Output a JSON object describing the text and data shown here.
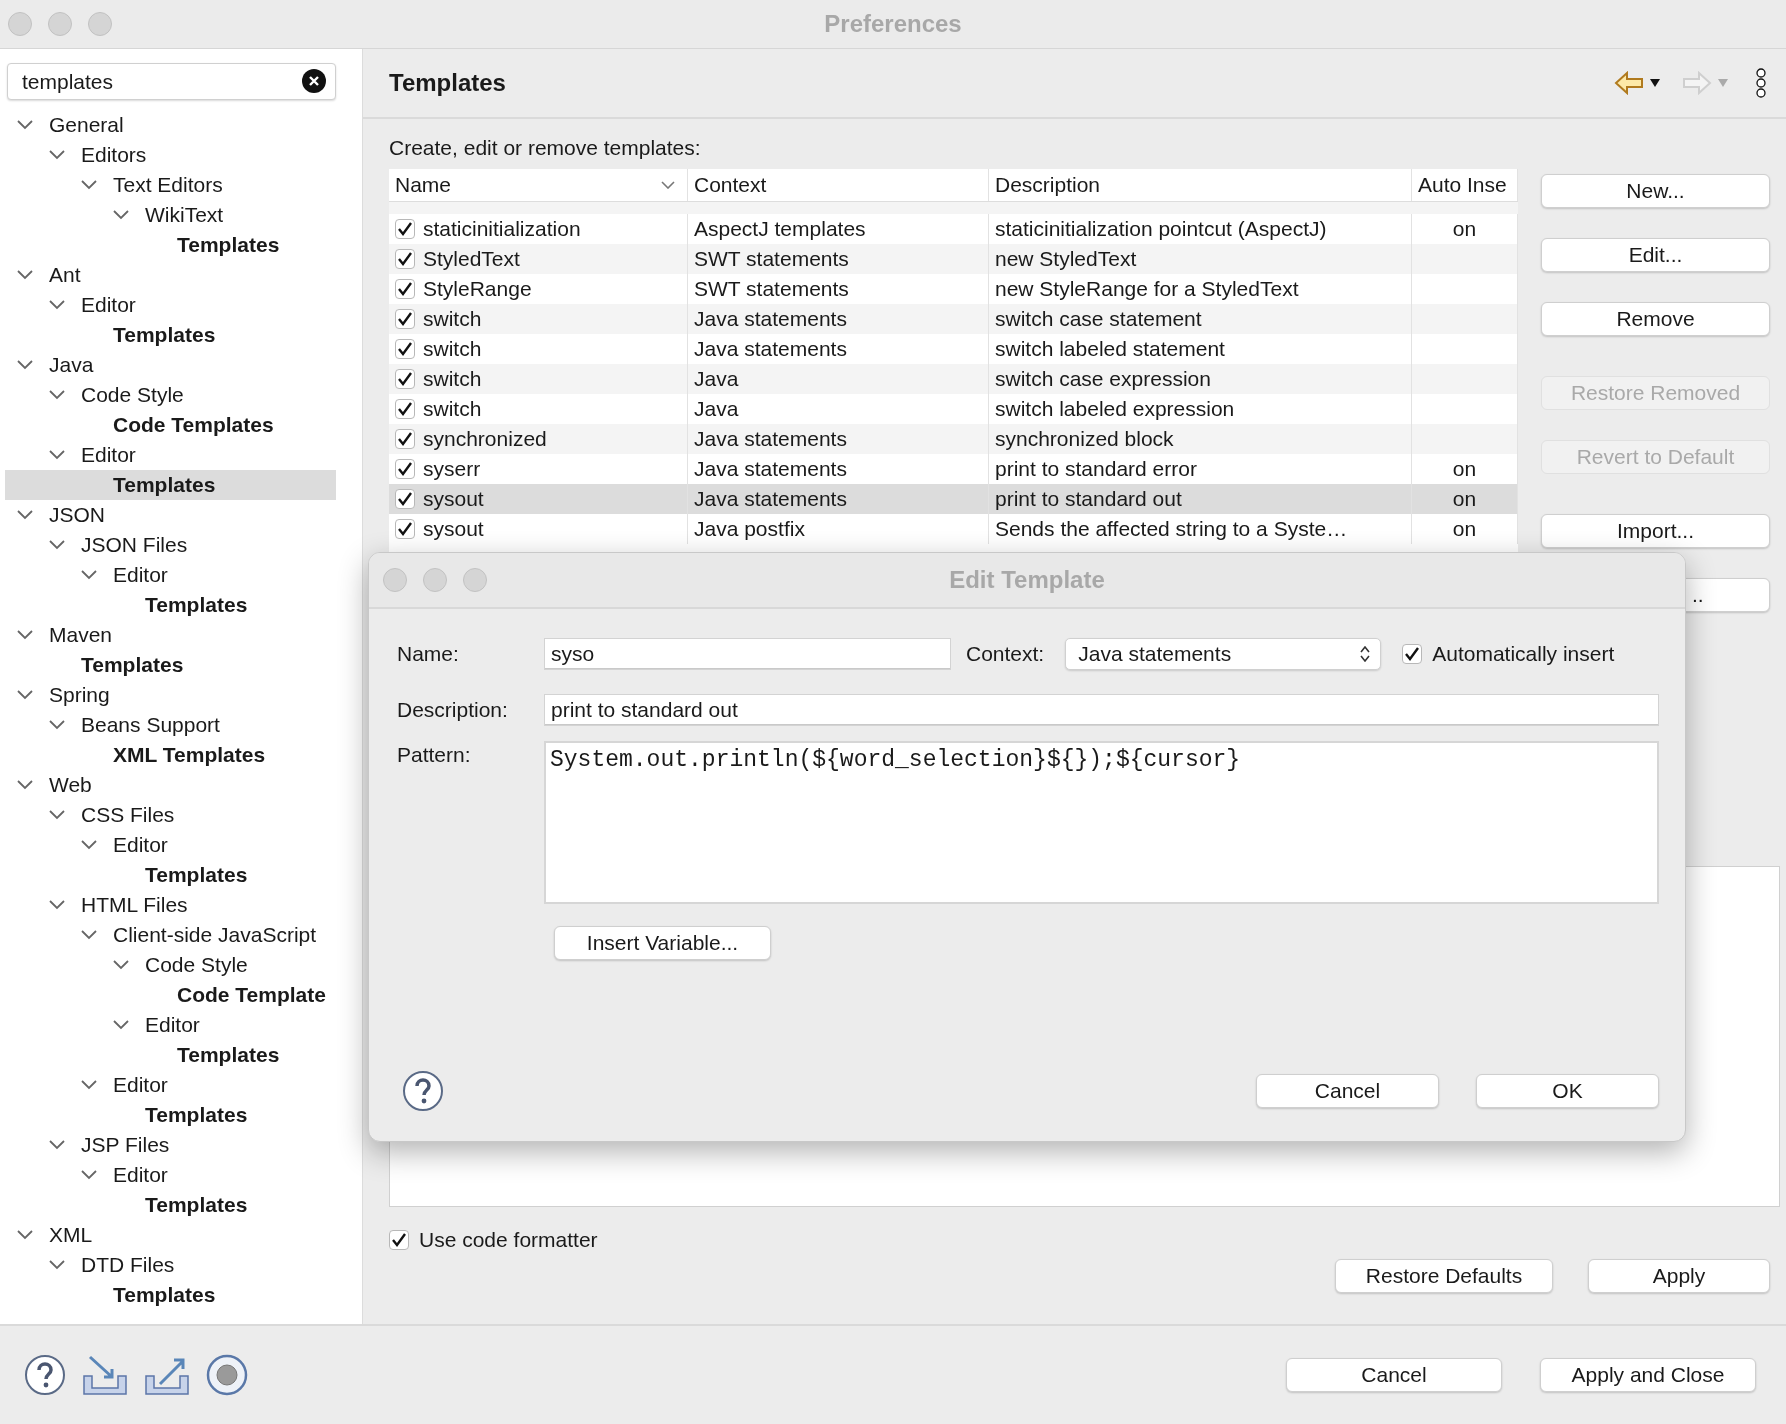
{
  "window": {
    "title": "Preferences"
  },
  "sidebar": {
    "search": {
      "value": "templates"
    },
    "tree": [
      {
        "label": "General",
        "bold": false,
        "selected": false,
        "expanded": true,
        "children": [
          {
            "label": "Editors",
            "bold": false,
            "selected": false,
            "expanded": true,
            "children": [
              {
                "label": "Text Editors",
                "bold": false,
                "selected": false,
                "expanded": true,
                "children": [
                  {
                    "label": "WikiText",
                    "bold": false,
                    "selected": false,
                    "expanded": true,
                    "children": [
                      {
                        "label": "Templates",
                        "bold": true,
                        "selected": false
                      }
                    ]
                  }
                ]
              }
            ]
          }
        ]
      },
      {
        "label": "Ant",
        "bold": false,
        "selected": false,
        "expanded": true,
        "children": [
          {
            "label": "Editor",
            "bold": false,
            "selected": false,
            "expanded": true,
            "children": [
              {
                "label": "Templates",
                "bold": true,
                "selected": false
              }
            ]
          }
        ]
      },
      {
        "label": "Java",
        "bold": false,
        "selected": false,
        "expanded": true,
        "children": [
          {
            "label": "Code Style",
            "bold": false,
            "selected": false,
            "expanded": true,
            "children": [
              {
                "label": "Code Templates",
                "bold": true,
                "selected": false
              }
            ]
          },
          {
            "label": "Editor",
            "bold": false,
            "selected": false,
            "expanded": true,
            "children": [
              {
                "label": "Templates",
                "bold": true,
                "selected": true
              }
            ]
          }
        ]
      },
      {
        "label": "JSON",
        "bold": false,
        "selected": false,
        "expanded": true,
        "children": [
          {
            "label": "JSON Files",
            "bold": false,
            "selected": false,
            "expanded": true,
            "children": [
              {
                "label": "Editor",
                "bold": false,
                "selected": false,
                "expanded": true,
                "children": [
                  {
                    "label": "Templates",
                    "bold": true,
                    "selected": false
                  }
                ]
              }
            ]
          }
        ]
      },
      {
        "label": "Maven",
        "bold": false,
        "selected": false,
        "expanded": true,
        "children": [
          {
            "label": "Templates",
            "bold": true,
            "selected": false
          }
        ]
      },
      {
        "label": "Spring",
        "bold": false,
        "selected": false,
        "expanded": true,
        "children": [
          {
            "label": "Beans Support",
            "bold": false,
            "selected": false,
            "expanded": true,
            "children": [
              {
                "label": "XML Templates",
                "bold": true,
                "selected": false
              }
            ]
          }
        ]
      },
      {
        "label": "Web",
        "bold": false,
        "selected": false,
        "expanded": true,
        "children": [
          {
            "label": "CSS Files",
            "bold": false,
            "selected": false,
            "expanded": true,
            "children": [
              {
                "label": "Editor",
                "bold": false,
                "selected": false,
                "expanded": true,
                "children": [
                  {
                    "label": "Templates",
                    "bold": true,
                    "selected": false
                  }
                ]
              }
            ]
          },
          {
            "label": "HTML Files",
            "bold": false,
            "selected": false,
            "expanded": true,
            "children": [
              {
                "label": "Client-side JavaScript",
                "bold": false,
                "selected": false,
                "expanded": true,
                "children": [
                  {
                    "label": "Code Style",
                    "bold": false,
                    "selected": false,
                    "expanded": true,
                    "children": [
                      {
                        "label": "Code Template",
                        "bold": true,
                        "selected": false
                      }
                    ]
                  },
                  {
                    "label": "Editor",
                    "bold": false,
                    "selected": false,
                    "expanded": true,
                    "children": [
                      {
                        "label": "Templates",
                        "bold": true,
                        "selected": false
                      }
                    ]
                  }
                ]
              },
              {
                "label": "Editor",
                "bold": false,
                "selected": false,
                "expanded": true,
                "children": [
                  {
                    "label": "Templates",
                    "bold": true,
                    "selected": false
                  }
                ]
              }
            ]
          },
          {
            "label": "JSP Files",
            "bold": false,
            "selected": false,
            "expanded": true,
            "children": [
              {
                "label": "Editor",
                "bold": false,
                "selected": false,
                "expanded": true,
                "children": [
                  {
                    "label": "Templates",
                    "bold": true,
                    "selected": false
                  }
                ]
              }
            ]
          }
        ]
      },
      {
        "label": "XML",
        "bold": false,
        "selected": false,
        "expanded": true,
        "children": [
          {
            "label": "DTD Files",
            "bold": false,
            "selected": false,
            "expanded": true,
            "children": [
              {
                "label": "Templates",
                "bold": true,
                "selected": false
              }
            ]
          }
        ]
      }
    ]
  },
  "page": {
    "title": "Templates",
    "back_enabled": true,
    "forward_enabled": false,
    "intro": "Create, edit or remove templates:"
  },
  "table": {
    "columns": [
      "Name",
      "Context",
      "Description",
      "Auto Inse"
    ],
    "rows": [
      {
        "checked": true,
        "selected": false,
        "name": "staticinitialization",
        "context": "AspectJ templates",
        "description": "staticinitialization pointcut (AspectJ)",
        "auto": "on"
      },
      {
        "checked": true,
        "selected": false,
        "name": "StyledText",
        "context": "SWT statements",
        "description": "new StyledText"
      },
      {
        "checked": true,
        "selected": false,
        "name": "StyleRange",
        "context": "SWT statements",
        "description": "new StyleRange for a StyledText"
      },
      {
        "checked": true,
        "selected": false,
        "name": "switch",
        "context": "Java statements",
        "description": "switch case statement"
      },
      {
        "checked": true,
        "selected": false,
        "name": "switch",
        "context": "Java statements",
        "description": "switch labeled statement"
      },
      {
        "checked": true,
        "selected": false,
        "name": "switch",
        "context": "Java",
        "description": "switch case expression"
      },
      {
        "checked": true,
        "selected": false,
        "name": "switch",
        "context": "Java",
        "description": "switch labeled expression"
      },
      {
        "checked": true,
        "selected": false,
        "name": "synchronized",
        "context": "Java statements",
        "description": "synchronized block"
      },
      {
        "checked": true,
        "selected": false,
        "name": "syserr",
        "context": "Java statements",
        "description": "print to standard error",
        "auto": "on"
      },
      {
        "checked": true,
        "selected": true,
        "name": "sysout",
        "context": "Java statements",
        "description": "print to standard out",
        "auto": "on"
      },
      {
        "checked": true,
        "selected": false,
        "name": "sysout",
        "context": "Java postfix",
        "description": "Sends the affected string to a Syste…",
        "auto": "on"
      }
    ]
  },
  "side_button_groups": [
    [
      {
        "label": "New...",
        "disabled": false
      },
      {
        "label": "Edit...",
        "disabled": false
      },
      {
        "label": "Remove",
        "disabled": false
      }
    ],
    [
      {
        "label": "Restore Removed",
        "disabled": true
      },
      {
        "label": "Revert to Default",
        "disabled": true
      }
    ],
    [
      {
        "label": "Import...",
        "disabled": false
      },
      {
        "label": "..",
        "disabled": false
      }
    ]
  ],
  "use_formatter": {
    "label": "Use code formatter",
    "checked": true
  },
  "page_buttons": [
    "Restore Defaults",
    "Apply"
  ],
  "dialog_buttons_main": [
    "Cancel",
    "Apply and Close"
  ],
  "dialog": {
    "title": "Edit Template",
    "name_label": "Name:",
    "name": "syso",
    "context_label": "Context:",
    "context": "Java statements",
    "auto_insert": {
      "label": "Automatically insert",
      "checked": true
    },
    "description_label": "Description:",
    "description": "print to standard out",
    "pattern_label": "Pattern:",
    "pattern": "System.out.println(${word_selection}${});${cursor}",
    "insert_variable": "Insert Variable...",
    "buttons": [
      "Cancel",
      "OK"
    ]
  }
}
